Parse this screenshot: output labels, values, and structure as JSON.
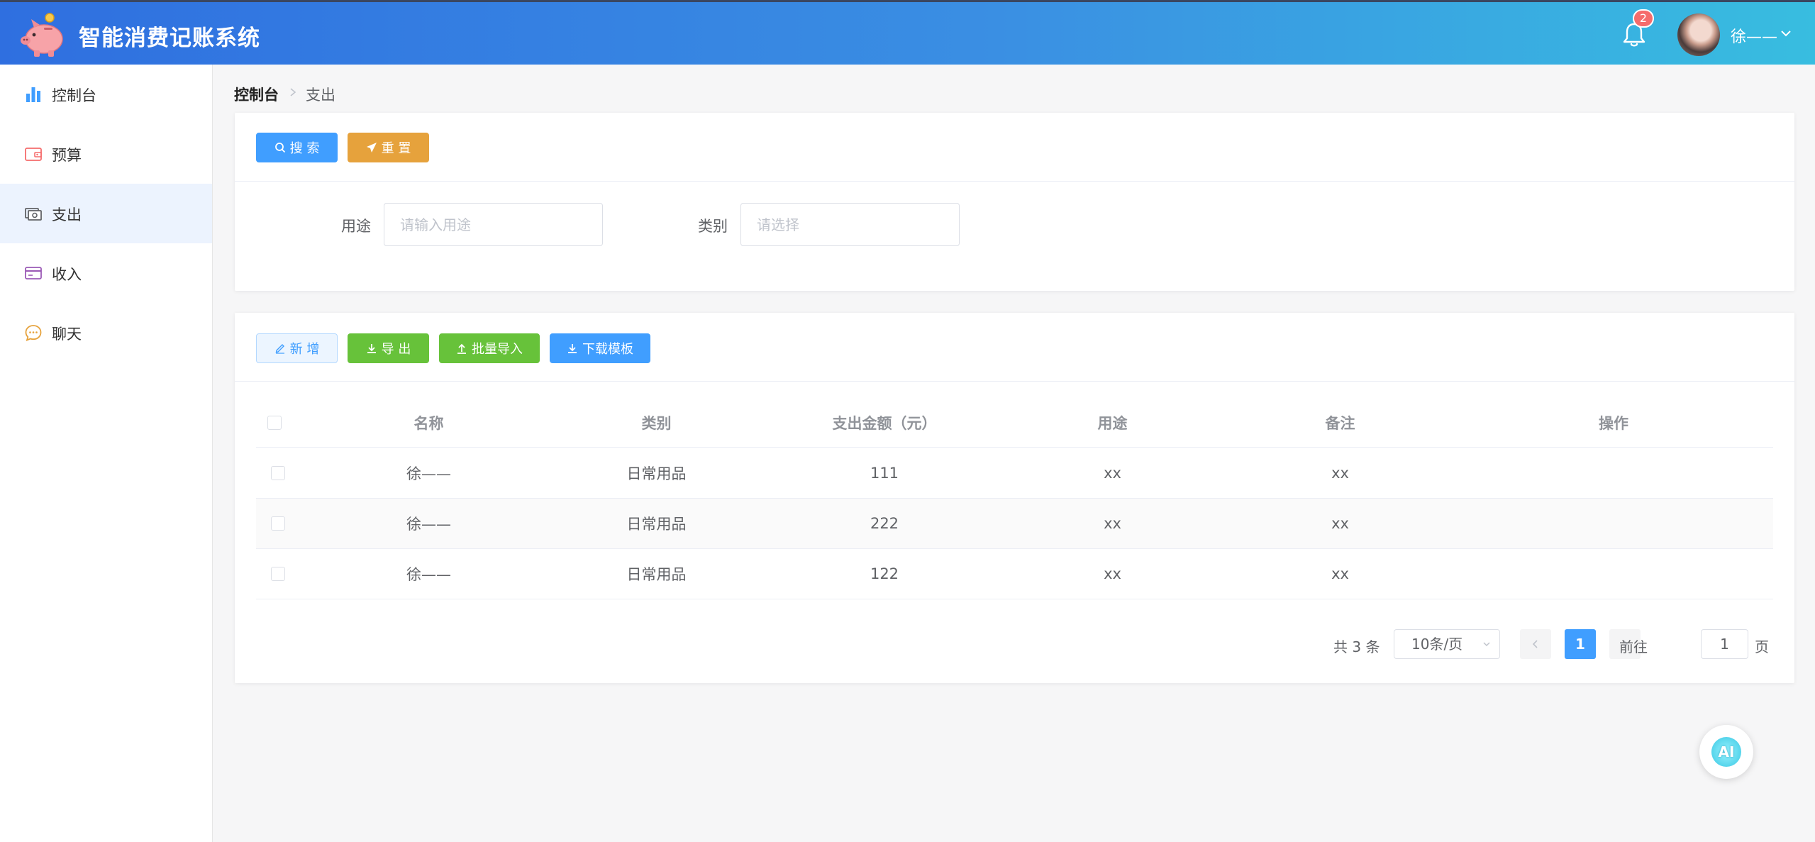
{
  "app": {
    "title": "智能消费记账系统",
    "notification_count": "2",
    "username": "徐——"
  },
  "sidebar": {
    "items": [
      {
        "label": "控制台",
        "icon": "bar-chart-icon",
        "active": false
      },
      {
        "label": "预算",
        "icon": "wallet-icon",
        "active": false
      },
      {
        "label": "支出",
        "icon": "money-icon",
        "active": true
      },
      {
        "label": "收入",
        "icon": "card-icon",
        "active": false
      },
      {
        "label": "聊天",
        "icon": "chat-icon",
        "active": false
      }
    ]
  },
  "breadcrumb": {
    "root": "控制台",
    "current": "支出"
  },
  "search": {
    "search_label": "搜 索",
    "reset_label": "重 置",
    "purpose_label": "用途",
    "purpose_placeholder": "请输入用途",
    "category_label": "类别",
    "category_placeholder": "请选择"
  },
  "toolbar": {
    "add_label": "新 增",
    "export_label": "导 出",
    "import_label": "批量导入",
    "template_label": "下载模板"
  },
  "table": {
    "columns": [
      "名称",
      "类别",
      "支出金额（元）",
      "用途",
      "备注",
      "操作"
    ],
    "rows": [
      {
        "name": "徐——",
        "category": "日常用品",
        "amount": "111",
        "purpose": "xx",
        "remark": "xx"
      },
      {
        "name": "徐——",
        "category": "日常用品",
        "amount": "222",
        "purpose": "xx",
        "remark": "xx"
      },
      {
        "name": "徐——",
        "category": "日常用品",
        "amount": "122",
        "purpose": "xx",
        "remark": "xx"
      }
    ]
  },
  "pagination": {
    "total": "共 3 条",
    "page_size": "10条/页",
    "current_page": "1",
    "goto_prefix": "前往",
    "goto_value": "1",
    "goto_suffix": "页"
  },
  "ai_button": {
    "label": "AI"
  },
  "colors": {
    "primary": "#409eff",
    "success": "#67c23a",
    "warning": "#e6a23c",
    "danger": "#f56c6c",
    "header_start": "#2f6fe0",
    "header_end": "#38bde0"
  }
}
